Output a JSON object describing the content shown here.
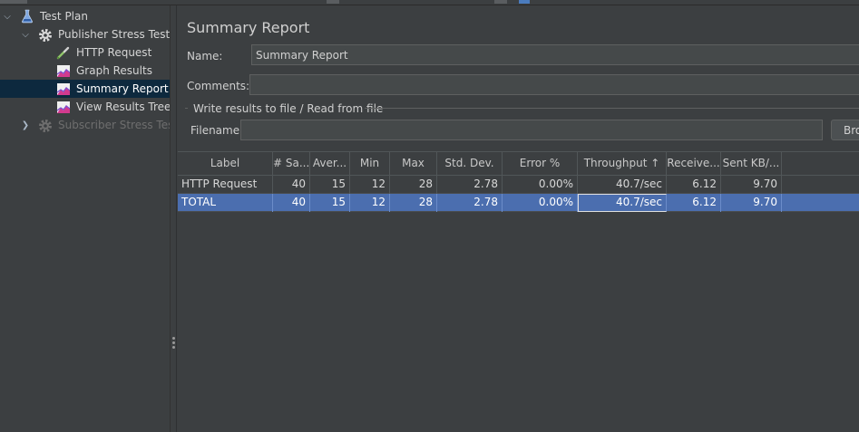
{
  "tree": {
    "items": [
      {
        "label": "Test Plan",
        "icon": "flask-icon",
        "expander": "expanded"
      },
      {
        "label": "Publisher Stress Testing",
        "icon": "gear-icon",
        "expander": "expanded"
      },
      {
        "label": "HTTP Request",
        "icon": "pipette-icon"
      },
      {
        "label": "Graph Results",
        "icon": "chart-icon"
      },
      {
        "label": "Summary Report",
        "icon": "chart-icon",
        "selected": true
      },
      {
        "label": "View Results Tree",
        "icon": "chart-icon"
      },
      {
        "label": "Subscriber Stress Testing",
        "icon": "gear-icon",
        "expander": "collapsed",
        "disabled": true
      }
    ]
  },
  "panel": {
    "title": "Summary Report",
    "name_label": "Name:",
    "name_value": "Summary Report",
    "comments_label": "Comments:",
    "comments_value": "",
    "file_group_label": "Write results to file / Read from file",
    "filename_label": "Filename",
    "filename_value": "",
    "browse_label": "Browse..."
  },
  "table": {
    "columns": [
      "Label",
      "# Sa...",
      "Aver...",
      "Min",
      "Max",
      "Std. Dev.",
      "Error %",
      "Throughput ↑",
      "Receive...",
      "Sent KB/..."
    ],
    "rows": [
      {
        "cells": [
          "HTTP Request",
          "40",
          "15",
          "12",
          "28",
          "2.78",
          "0.00%",
          "40.7/sec",
          "6.12",
          "9.70"
        ],
        "selected": false
      },
      {
        "cells": [
          "TOTAL",
          "40",
          "15",
          "12",
          "28",
          "2.78",
          "0.00%",
          "40.7/sec",
          "6.12",
          "9.70"
        ],
        "selected": true
      }
    ]
  },
  "colors": {
    "background": "#3c3f41",
    "selection": "#4b6eaf",
    "tree_selection": "#0d293e"
  }
}
